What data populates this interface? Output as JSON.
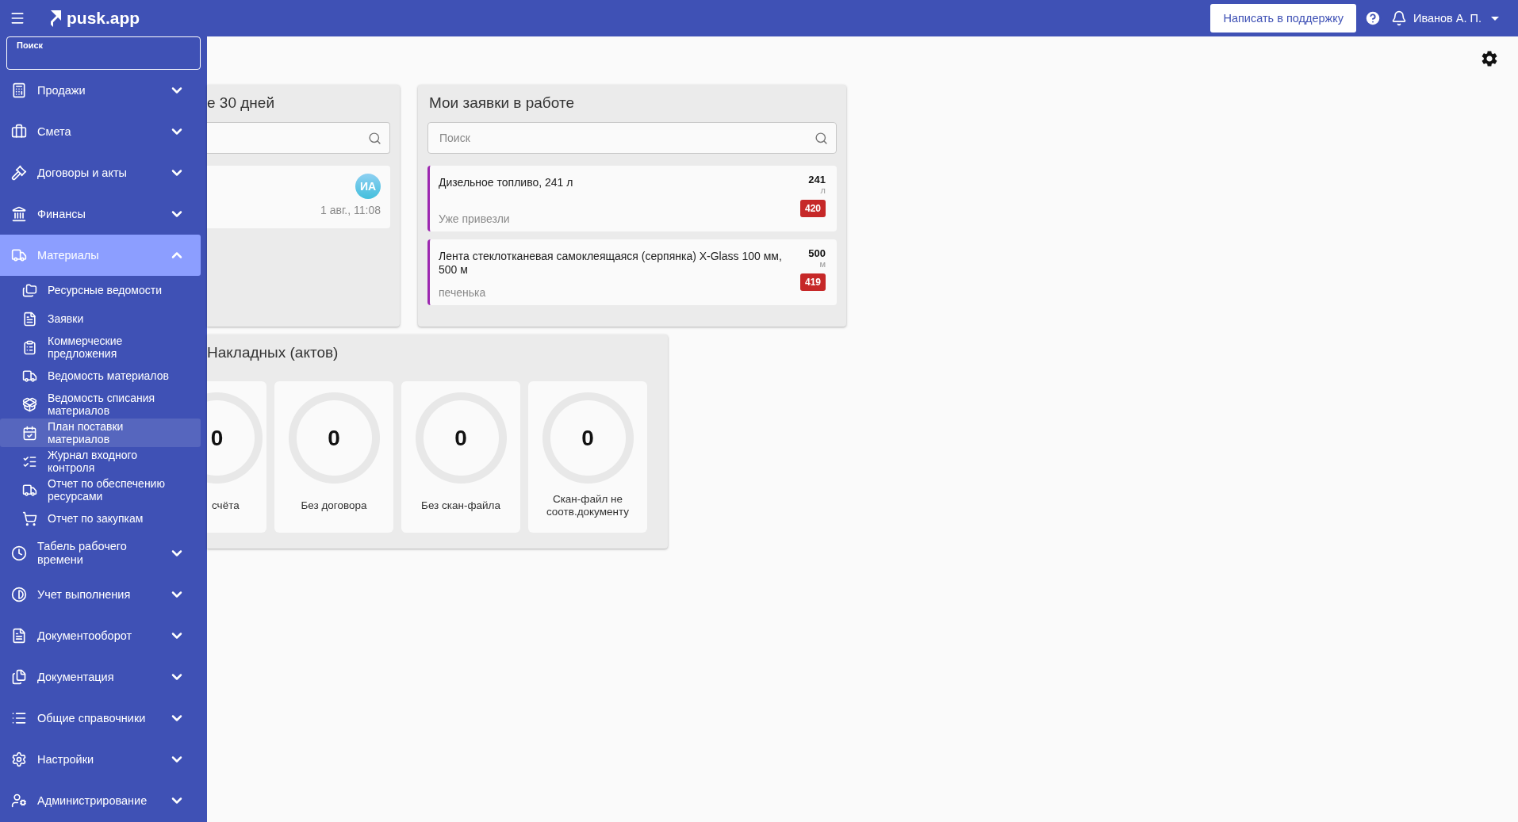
{
  "topbar": {
    "logo": "pusk.app",
    "support_button": "Написать в поддержку",
    "user": "Иванов А. П."
  },
  "sidebar": {
    "search": {
      "label": "Поиск"
    },
    "items": [
      {
        "label": "Продажи",
        "expanded": false
      },
      {
        "label": "Смета",
        "expanded": false
      },
      {
        "label": "Договоры и акты",
        "expanded": false
      },
      {
        "label": "Финансы",
        "expanded": false
      },
      {
        "label": "Материалы",
        "expanded": true,
        "children": [
          {
            "label": "Ресурсные ведомости",
            "highlighted": false
          },
          {
            "label": "Заявки",
            "highlighted": false
          },
          {
            "label": "Коммерческие предложения",
            "highlighted": false
          },
          {
            "label": "Ведомость материалов",
            "highlighted": false
          },
          {
            "label": "Ведомость списания материалов",
            "highlighted": false
          },
          {
            "label": "План поставки материалов",
            "highlighted": true
          },
          {
            "label": "Журнал входного контроля",
            "highlighted": false
          },
          {
            "label": "Отчет по обеспечению ресурсами",
            "highlighted": false
          },
          {
            "label": "Отчет по закупкам",
            "highlighted": false
          }
        ]
      },
      {
        "label": "Табель рабочего времени",
        "expanded": false
      },
      {
        "label": "Учет выполнения",
        "expanded": false
      },
      {
        "label": "Документооборот",
        "expanded": false
      },
      {
        "label": "Документация",
        "expanded": false
      },
      {
        "label": "Общие справочники",
        "expanded": false
      },
      {
        "label": "Настройки",
        "expanded": false
      },
      {
        "label": "Администрирование",
        "expanded": false
      }
    ]
  },
  "recent_card": {
    "title": "е 30 дней",
    "entries": [
      {
        "avatar": "ИА",
        "time": "1 авг., 11:08"
      }
    ]
  },
  "requests_card": {
    "title": "Мои заявки в работе",
    "search": {
      "placeholder": "Поиск"
    },
    "entries": [
      {
        "name": "Дизельное топливо, 241 л",
        "status": "Уже привезли",
        "quantity": "241",
        "unit": "л",
        "number": "420"
      },
      {
        "name": "Лента стеклотканевая самоклеящаяся (серпянка) X-Glass 100 мм, 500 м",
        "status": "печенька",
        "quantity": "500",
        "unit": "м",
        "number": "419"
      }
    ]
  },
  "invoices_card": {
    "title": "Накладных (актов)",
    "stats": [
      {
        "value": "0",
        "label": "счёта"
      },
      {
        "value": "0",
        "label": "Без договора"
      },
      {
        "value": "0",
        "label": "Без скан-файла"
      },
      {
        "value": "0",
        "label": "Скан-файл не соотв.документу"
      }
    ]
  }
}
